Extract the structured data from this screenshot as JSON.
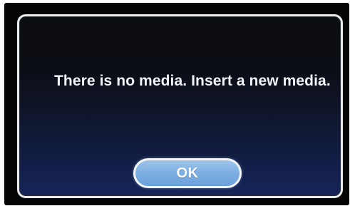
{
  "dialog": {
    "message": "There is no media. Insert a new media.",
    "ok_label": "OK"
  },
  "colors": {
    "dialog_border": "#e9ecef",
    "dialog_background_top": "#0c0d10",
    "dialog_background_bottom": "#15245a",
    "button_fill": "#7fb0e2",
    "text": "#f2f4f7"
  }
}
